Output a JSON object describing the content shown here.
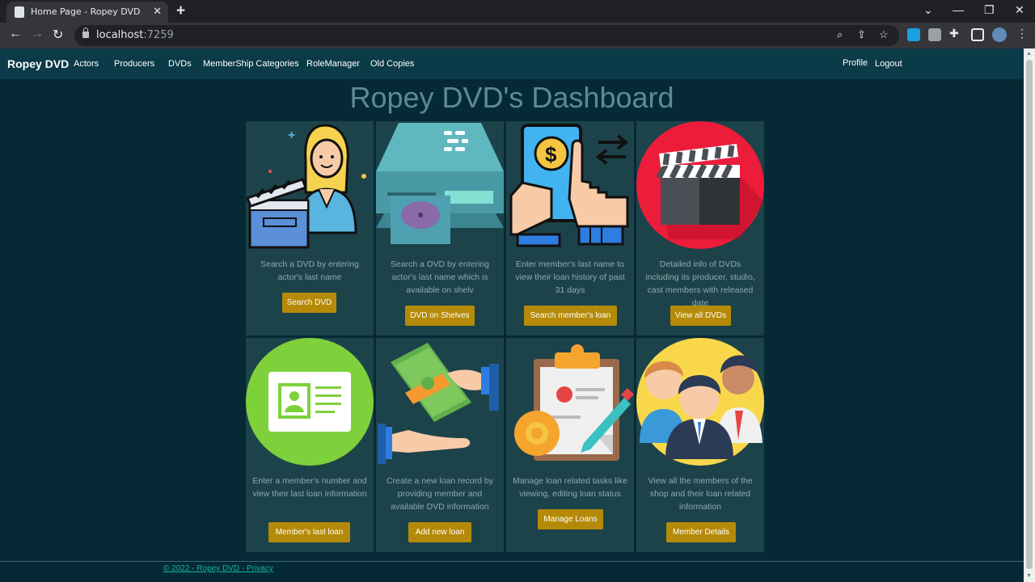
{
  "browser": {
    "tab_title": "Home Page - Ropey DVD",
    "url_host": "localhost",
    "url_port": ":7259"
  },
  "nav": {
    "brand": "Ropey DVD",
    "links": [
      "Actors",
      "Producers",
      "DVDs",
      "MemberShip Categories",
      "RoleManager",
      "Old Copies"
    ],
    "profile": "Profile",
    "logout": "Logout"
  },
  "page_title": "Ropey DVD's Dashboard",
  "cards": [
    {
      "icon": "actress-clapperboard-icon",
      "desc": "Search a DVD by entering actor's last name",
      "button": "Search DVD"
    },
    {
      "icon": "dvd-player-icon",
      "desc": "Search a DVD by entering actor's last name which is available on shelv",
      "button": "DVD on Shelves"
    },
    {
      "icon": "mobile-payment-icon",
      "desc": "Enter member's last name to view their loan history of past 31 days",
      "button": "Search member's loan"
    },
    {
      "icon": "clapperboard-icon",
      "desc": "Detailed info of DVDs including its producer, studio, cast members with released date",
      "button": "View all DVDs"
    },
    {
      "icon": "id-card-icon",
      "desc": "Enter a member's number and view their last loan information",
      "button": "Member's last loan"
    },
    {
      "icon": "money-hand-icon",
      "desc": "Create a new loan record by providing member and available DVD information",
      "button": "Add new loan"
    },
    {
      "icon": "clipboard-gear-icon",
      "desc": "Manage loan related tasks like viewing, editing loan status",
      "button": "Manage Loans"
    },
    {
      "icon": "team-members-icon",
      "desc": "View all the members of the shop and their loan related information",
      "button": "Member Details"
    }
  ],
  "footer": "© 2022 - Ropey DVD - Privacy",
  "colors": {
    "background": "#062a35",
    "navbar": "#0b3a48",
    "card": "#1d434a",
    "button": "#b58a08",
    "title": "#5c8a94"
  }
}
